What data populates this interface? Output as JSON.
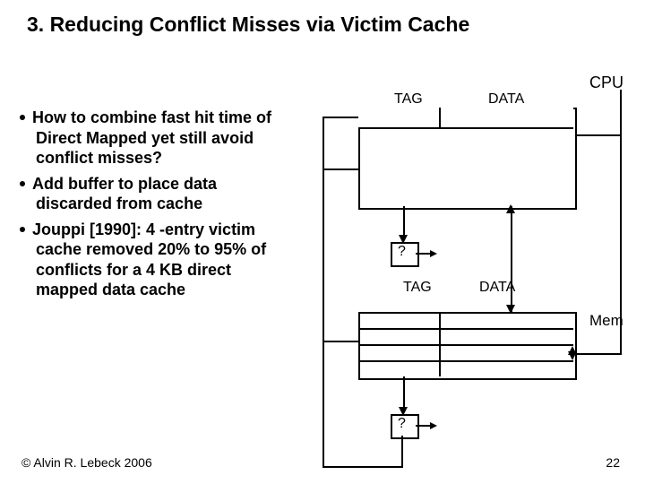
{
  "title": "3. Reducing Conflict Misses via Victim Cache",
  "cpu": "CPU",
  "bullets": {
    "b1": "How to combine fast hit time of Direct Mapped yet still avoid conflict misses?",
    "b2": "Add buffer to place data discarded from cache",
    "b3": "Jouppi [1990]: 4 -entry victim cache removed 20% to 95% of conflicts for a 4 KB direct mapped data cache"
  },
  "diagram": {
    "tag1": "TAG",
    "data1": "DATA",
    "q1": "?",
    "tag2": "TAG",
    "data2": "DATA",
    "q2": "?",
    "mem": "Mem"
  },
  "footer": {
    "copyright": "© Alvin R. Lebeck 2006",
    "page": "22"
  }
}
